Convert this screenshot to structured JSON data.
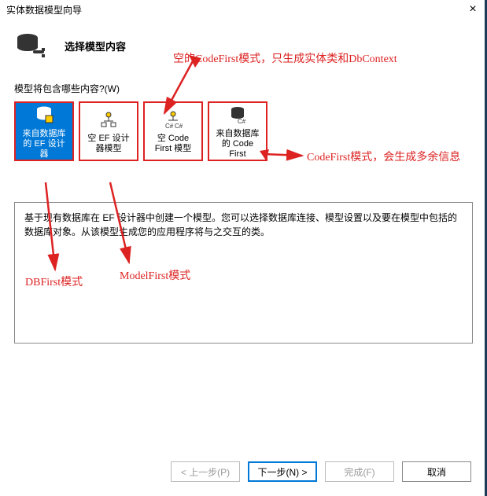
{
  "titlebar": {
    "title": "实体数据模型向导"
  },
  "header": {
    "heading": "选择模型内容"
  },
  "question": "模型将包含哪些内容?(W)",
  "options": [
    {
      "icon": "db-designer",
      "label": "来自数据库的 EF 设计器",
      "selected": true
    },
    {
      "icon": "designer-empty",
      "label": "空 EF 设计器模型",
      "selected": false
    },
    {
      "icon": "codefirst-empty",
      "label": "空 Code First 模型",
      "selected": false
    },
    {
      "icon": "db-codefirst",
      "label": "来自数据库的 Code First",
      "selected": false
    }
  ],
  "description": "基于现有数据库在 EF 设计器中创建一个模型。您可以选择数据库连接、模型设置以及要在模型中包括的数据库对象。从该模型生成您的应用程序将与之交互的类。",
  "annotations": {
    "empty_codefirst": "空的CodeFirst模式，只生成实体类和DbContext",
    "codefirst_extra": "CodeFirst模式，会生成多余信息",
    "dbfirst": "DBFirst模式",
    "modelfirst": "ModelFirst模式"
  },
  "buttons": {
    "prev": "< 上一步(P)",
    "next": "下一步(N) >",
    "finish": "完成(F)",
    "cancel": "取消"
  }
}
